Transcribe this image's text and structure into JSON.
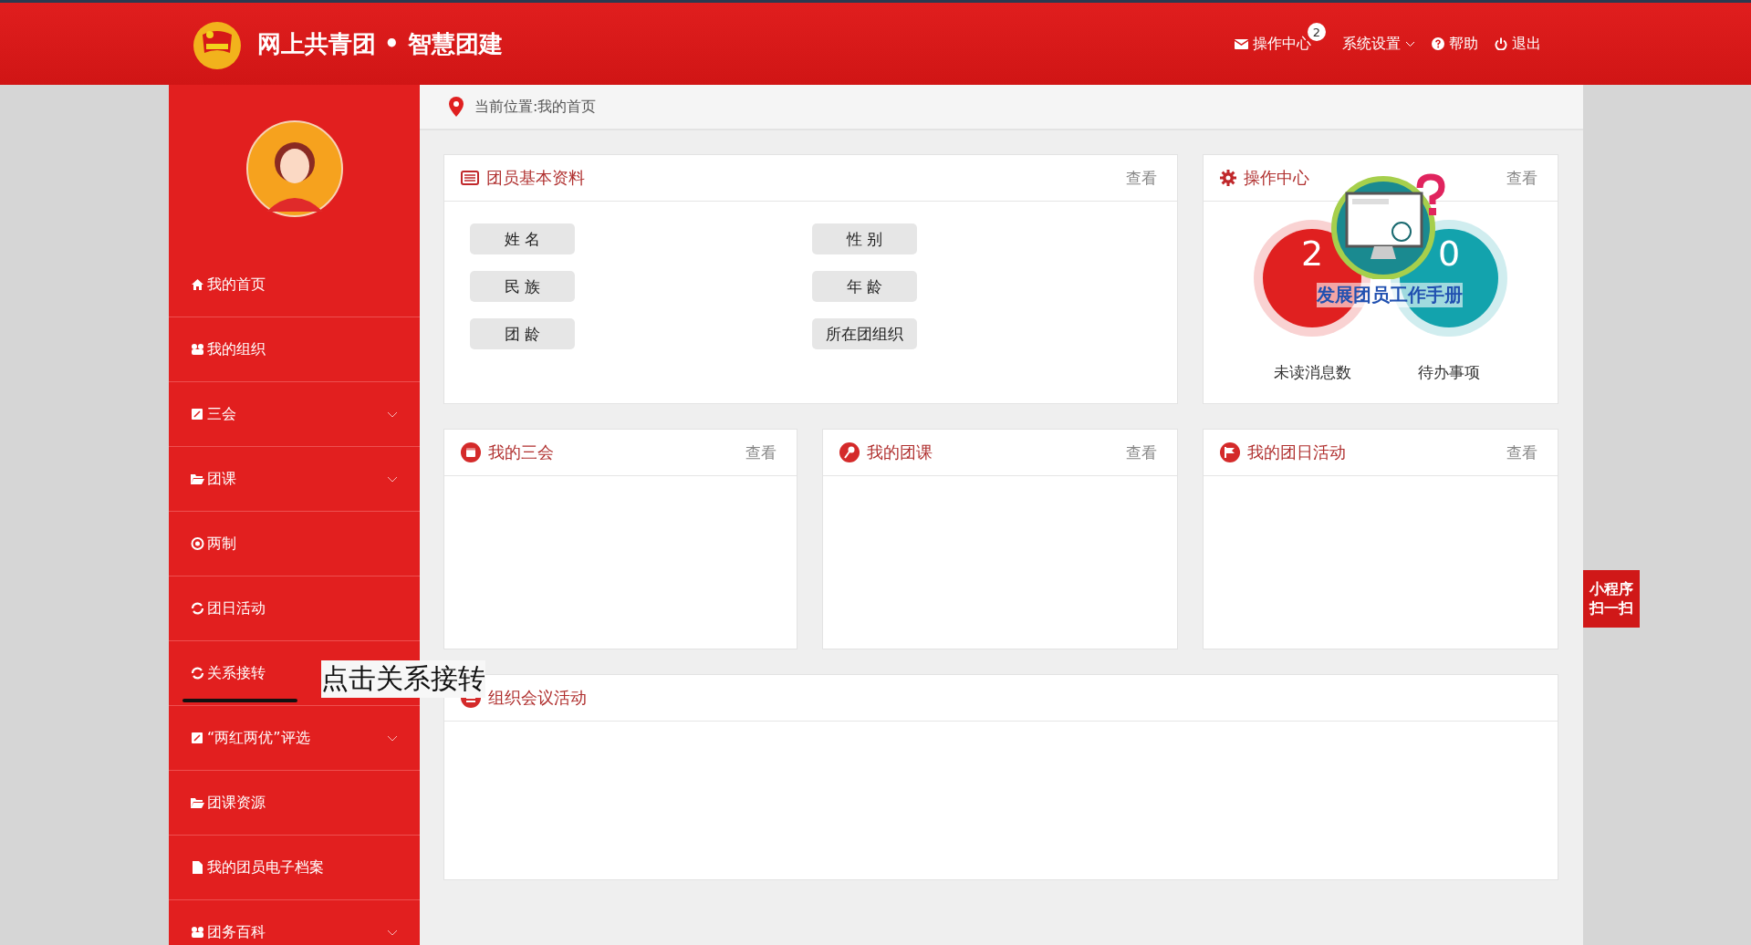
{
  "header": {
    "title": "网上共青团 • 智慧团建",
    "nav": [
      {
        "kind": "mail",
        "label": "操作中心",
        "badge": "2"
      },
      {
        "kind": "dropdown",
        "label": "系统设置"
      },
      {
        "kind": "help",
        "label": "帮助"
      },
      {
        "kind": "logout",
        "label": "退出"
      }
    ]
  },
  "sidebar": {
    "items": [
      {
        "label": "我的首页",
        "expandable": false
      },
      {
        "label": "我的组织",
        "expandable": false
      },
      {
        "label": "三会",
        "expandable": true
      },
      {
        "label": "团课",
        "expandable": true
      },
      {
        "label": "两制",
        "expandable": false
      },
      {
        "label": "团日活动",
        "expandable": false
      },
      {
        "label": "关系接转",
        "expandable": false
      },
      {
        "label": "“两红两优”评选",
        "expandable": true
      },
      {
        "label": "团课资源",
        "expandable": false
      },
      {
        "label": "我的团员电子档案",
        "expandable": false
      },
      {
        "label": "团务百科",
        "expandable": true
      }
    ]
  },
  "annotation": {
    "text": "点击关系接转"
  },
  "breadcrumb": "当前位置:我的首页",
  "basic_info": {
    "title": "团员基本资料",
    "link": "查看",
    "fields": [
      "姓 名",
      "性 别",
      "民 族",
      "年 龄",
      "团 龄",
      "所在团组织"
    ]
  },
  "ops_center": {
    "title": "操作中心",
    "link": "查看",
    "stats": [
      {
        "value": "2",
        "label": "未读消息数",
        "color": "#e02020"
      },
      {
        "value": "0",
        "label": "待办事项",
        "color": "#13a3ad"
      }
    ],
    "promo": "发展团员工作手册"
  },
  "panels": [
    {
      "title": "我的三会",
      "link": "查看"
    },
    {
      "title": "我的团课",
      "link": "查看"
    },
    {
      "title": "我的团日活动",
      "link": "查看"
    }
  ],
  "meetings": {
    "title": "组织会议活动"
  },
  "mini_program": [
    "小程序",
    "扫一扫"
  ]
}
